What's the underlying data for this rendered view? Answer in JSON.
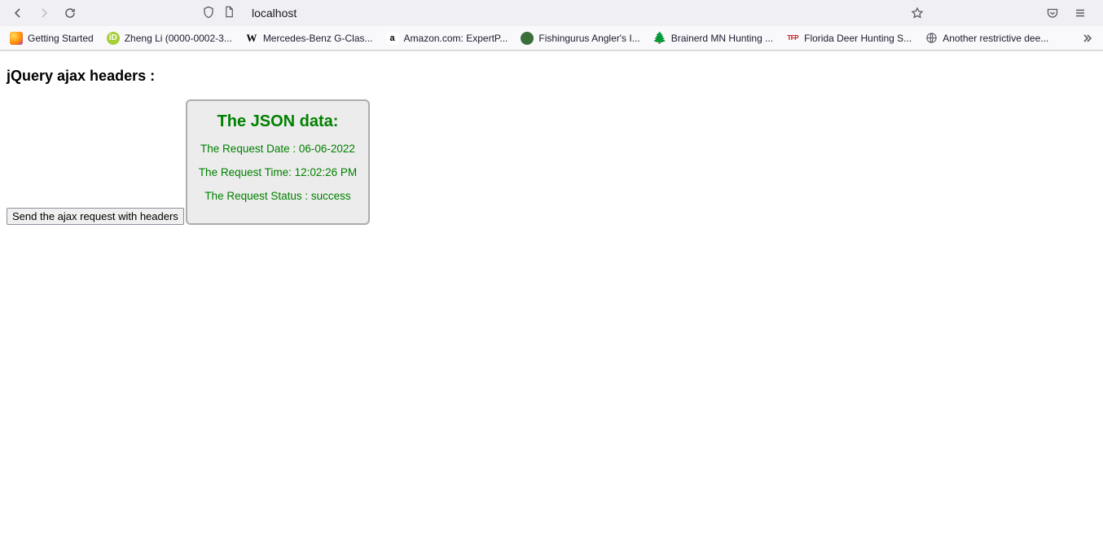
{
  "browser": {
    "url": "localhost",
    "bookmarks": [
      {
        "label": "Getting Started",
        "iconClass": "fx"
      },
      {
        "label": "Zheng Li (0000-0002-3...",
        "iconClass": "orcid",
        "iconText": "iD"
      },
      {
        "label": "Mercedes-Benz G-Clas...",
        "iconClass": "wiki",
        "iconText": "W"
      },
      {
        "label": "Amazon.com: ExpertP...",
        "iconClass": "amz",
        "iconText": "a"
      },
      {
        "label": "Fishingurus Angler's I...",
        "iconClass": "fish"
      },
      {
        "label": "Brainerd MN Hunting ...",
        "iconClass": "tree",
        "iconText": "🌲"
      },
      {
        "label": "Florida Deer Hunting S...",
        "iconClass": "tfp",
        "iconText": "TFP"
      },
      {
        "label": "Another restrictive dee...",
        "iconClass": "globe"
      }
    ]
  },
  "page": {
    "heading": "jQuery ajax headers :",
    "button_label": "Send the ajax request with headers",
    "json_box": {
      "title": "The JSON data:",
      "line1": "The Request Date : 06-06-2022",
      "line2": "The Request Time: 12:02:26 PM",
      "line3": "The Request Status : success"
    }
  }
}
